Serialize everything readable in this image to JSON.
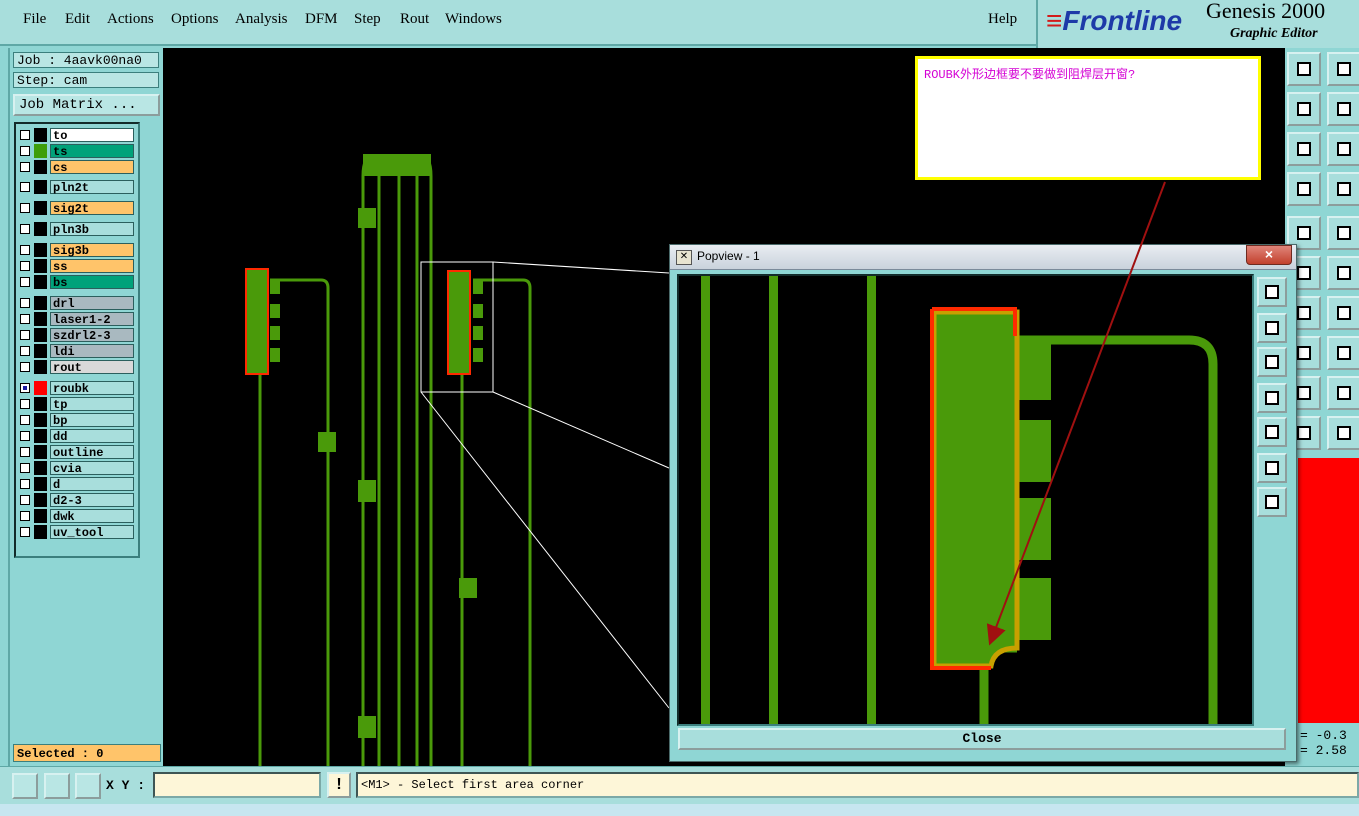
{
  "menu": {
    "items": [
      "File",
      "Edit",
      "Actions",
      "Options",
      "Analysis",
      "DFM",
      "Step",
      "Rout",
      "Windows"
    ],
    "help": "Help"
  },
  "brand": {
    "logo": "Frontline",
    "product": "Genesis 2000",
    "subtitle": "Graphic Editor"
  },
  "job": {
    "job_label": "Job : 4aavk00na0",
    "step_label": "Step: cam",
    "matrix_button": "Job Matrix ..."
  },
  "layers": [
    {
      "name": "to",
      "color": "#ffffff",
      "swatch": "#000000"
    },
    {
      "name": "ts",
      "color": "#00a27a",
      "swatch": "#3e9e0a"
    },
    {
      "name": "cs",
      "color": "#ffc46a",
      "swatch": "#000000"
    },
    {
      "name": "pln2t",
      "color": "#a8dedc",
      "swatch": "#000000"
    },
    {
      "name": "sig2t",
      "color": "#ffc46a",
      "swatch": "#000000"
    },
    {
      "name": "pln3b",
      "color": "#a8dedc",
      "swatch": "#000000"
    },
    {
      "name": "sig3b",
      "color": "#ffc46a",
      "swatch": "#000000"
    },
    {
      "name": "ss",
      "color": "#ffc46a",
      "swatch": "#000000"
    },
    {
      "name": "bs",
      "color": "#00a27a",
      "swatch": "#000000"
    },
    {
      "name": "drl",
      "color": "#a9b9c0",
      "swatch": "#000000"
    },
    {
      "name": "laser1-2",
      "color": "#a9b9c0",
      "swatch": "#000000"
    },
    {
      "name": "szdrl2-3",
      "color": "#a9b9c0",
      "swatch": "#000000"
    },
    {
      "name": "ldi",
      "color": "#a9b9c0",
      "swatch": "#000000"
    },
    {
      "name": "rout",
      "color": "#d9d9d9",
      "swatch": "#000000"
    },
    {
      "name": "roubk",
      "color": "#a8dedc",
      "swatch": "#ff0000"
    },
    {
      "name": "tp",
      "color": "#a8dedc",
      "swatch": "#000000"
    },
    {
      "name": "bp",
      "color": "#a8dedc",
      "swatch": "#000000"
    },
    {
      "name": "dd",
      "color": "#a8dedc",
      "swatch": "#000000"
    },
    {
      "name": "outline",
      "color": "#a8dedc",
      "swatch": "#000000"
    },
    {
      "name": "cvia",
      "color": "#a8dedc",
      "swatch": "#000000"
    },
    {
      "name": "d",
      "color": "#a8dedc",
      "swatch": "#000000"
    },
    {
      "name": "d2-3",
      "color": "#a8dedc",
      "swatch": "#000000"
    },
    {
      "name": "dwk",
      "color": "#a8dedc",
      "swatch": "#000000"
    },
    {
      "name": "uv_tool",
      "color": "#a8dedc",
      "swatch": "#000000"
    }
  ],
  "selected_label": "Selected : 0",
  "comment": "ROUBK外形边框要不要做到阻焊层开窗?",
  "popview": {
    "title": "Popview - 1",
    "close_x": "×",
    "close_button": "Close"
  },
  "coords": {
    "x": "= -0.3",
    "y": "= 2.58"
  },
  "status": {
    "xy_label": "X Y :",
    "xy_value": "",
    "warn": "!",
    "message": "<M1> - Select first area corner"
  },
  "colors": {
    "trace": "#4a9a0a",
    "outline": "#ff2a00",
    "pad_yellow": "#c8a000"
  }
}
